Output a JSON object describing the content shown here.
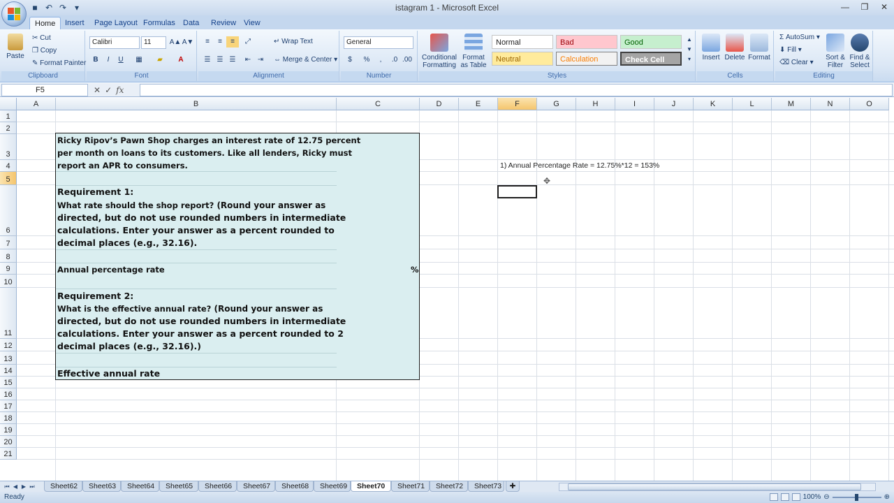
{
  "window": {
    "title": "istagram 1 - Microsoft Excel"
  },
  "tabs": [
    "Home",
    "Insert",
    "Page Layout",
    "Formulas",
    "Data",
    "Review",
    "View"
  ],
  "ribbon": {
    "clipboard": {
      "paste": "Paste",
      "cut": "Cut",
      "copy": "Copy",
      "format_painter": "Format Painter",
      "label": "Clipboard"
    },
    "font": {
      "name": "Calibri",
      "size": "11",
      "bold": "B",
      "italic": "I",
      "underline": "U",
      "label": "Font"
    },
    "alignment": {
      "wrap_text": "Wrap Text",
      "merge_center": "Merge & Center",
      "label": "Alignment"
    },
    "number": {
      "format": "General",
      "currency": "$",
      "percent": "%",
      "comma": ",",
      "label": "Number"
    },
    "styles": {
      "conditional": "Conditional Formatting",
      "format_table": "Format as Table",
      "cells": [
        "Normal",
        "Bad",
        "Good",
        "Neutral",
        "Calculation",
        "Check Cell"
      ],
      "label": "Styles"
    },
    "cells": {
      "insert": "Insert",
      "delete": "Delete",
      "format": "Format",
      "label": "Cells"
    },
    "editing": {
      "autosum": "AutoSum",
      "fill": "Fill",
      "clear": "Clear",
      "sort_filter": "Sort & Filter",
      "find_select": "Find & Select",
      "label": "Editing"
    }
  },
  "formula_bar": {
    "name_box": "F5",
    "fx": "fx",
    "value": ""
  },
  "columns": [
    "A",
    "B",
    "C",
    "D",
    "E",
    "F",
    "G",
    "H",
    "I",
    "J",
    "K",
    "L",
    "M",
    "N",
    "O"
  ],
  "rows": [
    "1",
    "2",
    "3",
    "4",
    "5",
    "6",
    "7",
    "8",
    "9",
    "10",
    "11",
    "12",
    "13",
    "14",
    "15",
    "16",
    "17",
    "18",
    "19",
    "20",
    "21"
  ],
  "selected_cell": {
    "column": "F",
    "row": "5"
  },
  "problem": {
    "intro_1": "Ricky Ripov’s Pawn Shop charges an interest rate of 12.75 percent",
    "intro_2": "per month on loans to its customers. Like all lenders, Ricky must",
    "intro_3": "report an APR to consumers.",
    "req1_title": "Requirement 1:",
    "req1_a": "What rate should the shop report?",
    "req1_b": " (Round your answer as",
    "req1_c": "directed, but do not use rounded numbers in intermediate",
    "req1_d": "calculations. Enter your answer as a percent rounded to",
    "req1_e": "decimal places (e.g., 32.16).",
    "apr_label": "Annual percentage rate",
    "apr_unit": "%",
    "req2_title": "Requirement 2:",
    "req2_a": "What is the effective annual rate?",
    "req2_b": " (Round your answer as",
    "req2_c": "directed, but do not use rounded numbers in intermediate",
    "req2_d": "calculations. Enter your answer as a percent rounded to 2",
    "req2_e": "decimal places (e.g., 32.16).)",
    "ear_label": "Effective annual rate"
  },
  "annotation": "1) Annual Percentage Rate = 12.75%*12 = 153%",
  "sheets": [
    "Sheet62",
    "Sheet63",
    "Sheet64",
    "Sheet65",
    "Sheet66",
    "Sheet67",
    "Sheet68",
    "Sheet69",
    "Sheet70",
    "Sheet71",
    "Sheet72",
    "Sheet73"
  ],
  "active_sheet": "Sheet70",
  "status": {
    "ready": "Ready",
    "zoom": "100%"
  },
  "colors": {
    "problem_fill": "#daeef0",
    "selection_header": "#f5c56d",
    "ribbon_text": "#1e3f6f"
  }
}
